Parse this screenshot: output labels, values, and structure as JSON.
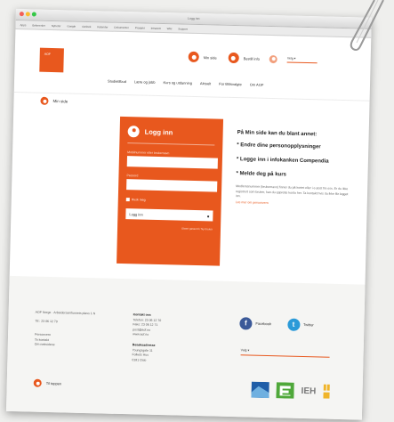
{
  "window": {
    "title": "Logg inn"
  },
  "bookmarks": [
    "Apps",
    "Bokmerker",
    "Nyheter",
    "Google",
    "Outlook",
    "Kalender",
    "Dokumenter",
    "Prosjekt",
    "Intranett",
    "Wiki",
    "Support"
  ],
  "header": {
    "logo_text": "AOF",
    "min_side": "Min side",
    "bestill": "Bestill info",
    "select_label": "Velg ▾",
    "nav": [
      "Studietilbud",
      "Lære og jobb",
      "Kurs og utdanning",
      "Aktuelt",
      "For tillitsvalgte",
      "Om AOF"
    ]
  },
  "breadcrumb": {
    "label": "Min side"
  },
  "login": {
    "title": "Logg inn",
    "username_label": "Mobilnummer eller brukernavn",
    "password_label": "Passord",
    "remember": "Husk meg",
    "button": "Logg inn",
    "forgot": "Glemt passord / Ny bruker"
  },
  "info": {
    "heading": "På Min side kan du blant annet:",
    "bullets": [
      "* Endre dine personopplysninger",
      "* Logge inn i infokanken Compendia",
      "* Melde deg på kurs"
    ],
    "body": "Medlemsnummer (brukernavn) finner du på kortet eller i e-post fra oss. Er du ikke registrert som bruker, kan du opprette konto her. Ta kontakt hvis du ikke får logget inn.",
    "link": "Les mer om personvern"
  },
  "footer": {
    "address": "AOF Norge · Arbeidersamfunnets plass 1 N",
    "phone": "Tlf.: 23 06 12 70",
    "privacy": [
      "Personvern",
      "Ta kontakt",
      "Om nettsidene"
    ],
    "col2_title": "Kontakt oss",
    "col2": [
      "Telefon: 23 06 12 70",
      "Faks: 23 06 12 71",
      "post@aof.no",
      "www.aof.no"
    ],
    "col3_title": "Besøksadresse",
    "col3": [
      "Youngsgate 11",
      "Folkets Hus",
      "0181 Oslo"
    ],
    "facebook": "Facebook",
    "twitter": "Twitter",
    "select": "Velg ▾",
    "back": "Til toppen",
    "ieh": "IEH"
  },
  "colors": {
    "accent": "#e8581e"
  }
}
